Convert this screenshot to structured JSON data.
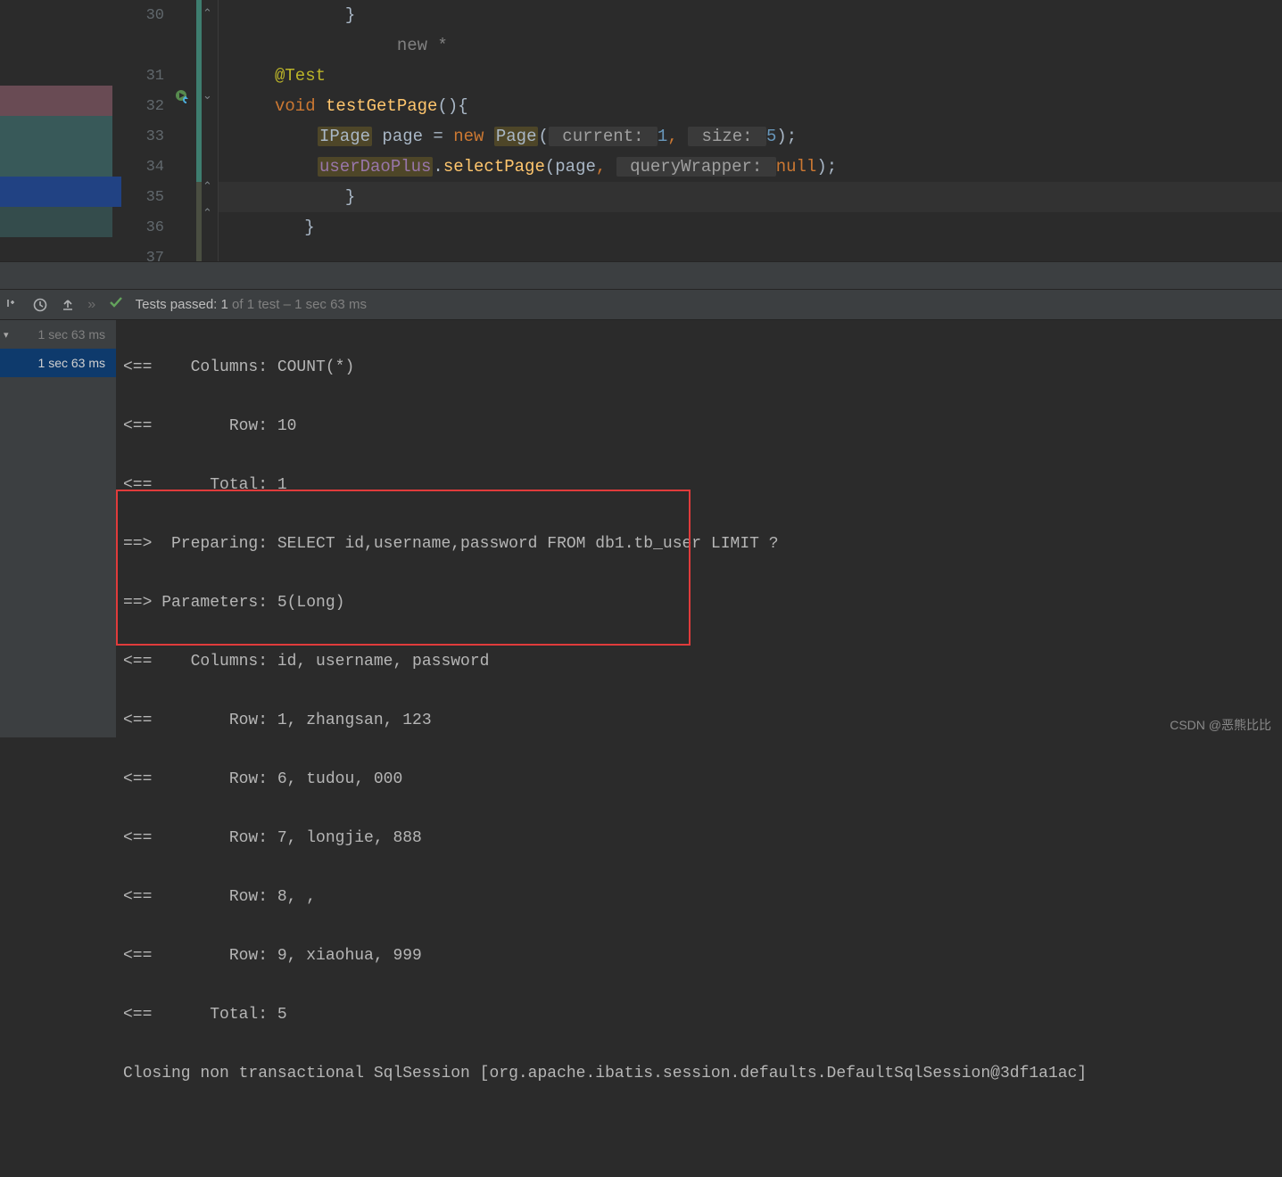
{
  "code": {
    "line_numbers": [
      "30",
      "",
      "31",
      "32",
      "33",
      "34",
      "35",
      "36",
      "37"
    ],
    "l30_brace": "            }",
    "l_newstar": "            new *",
    "l31_anno": "@Test",
    "l32_kw_void": "void",
    "l32_name": "testGetPage",
    "l32_tail": "(){",
    "l33_type": "IPage",
    "l33_var": "page",
    "l33_eq": " = ",
    "l33_new": "new",
    "l33_class": "Page",
    "l33_paren_open": "(",
    "l33_p1_label": " current: ",
    "l33_p1_val": "1",
    "l33_comma1": ",",
    "l33_p2_label": " size: ",
    "l33_p2_val": "5",
    "l33_tail": ");",
    "l34_field": "userDaoPlus",
    "l34_dot": ".",
    "l34_call": "selectPage",
    "l34_open": "(",
    "l34_arg1": "page",
    "l34_comma": ",",
    "l34_p_label": " queryWrapper: ",
    "l34_null": "null",
    "l34_tail": ");",
    "l35_brace": "            }",
    "l36_brace": "        }"
  },
  "toolbar": {
    "tests_passed_label": "Tests passed:",
    "tests_passed_count": "1",
    "tests_total": "of 1 test",
    "duration": "– 1 sec 63 ms"
  },
  "tree": {
    "row0": "1 sec 63 ms",
    "row1": "1 sec 63 ms"
  },
  "console": {
    "l1": "<==    Columns: COUNT(*)",
    "l2": "<==        Row: 10",
    "l3": "<==      Total: 1",
    "l4": "==>  Preparing: SELECT id,username,password FROM db1.tb_user LIMIT ?",
    "l5": "==> Parameters: 5(Long)",
    "l6": "<==    Columns: id, username, password",
    "l7": "<==        Row: 1, zhangsan, 123",
    "l8": "<==        Row: 6, tudou, 000",
    "l9": "<==        Row: 7, longjie, 888",
    "l10": "<==        Row: 8, ,",
    "l11": "<==        Row: 9, xiaohua, 999",
    "l12": "<==      Total: 5",
    "l13": "Closing non transactional SqlSession [org.apache.ibatis.session.defaults.DefaultSqlSession@3df1a1ac]"
  },
  "watermark": "CSDN @恶熊比比"
}
